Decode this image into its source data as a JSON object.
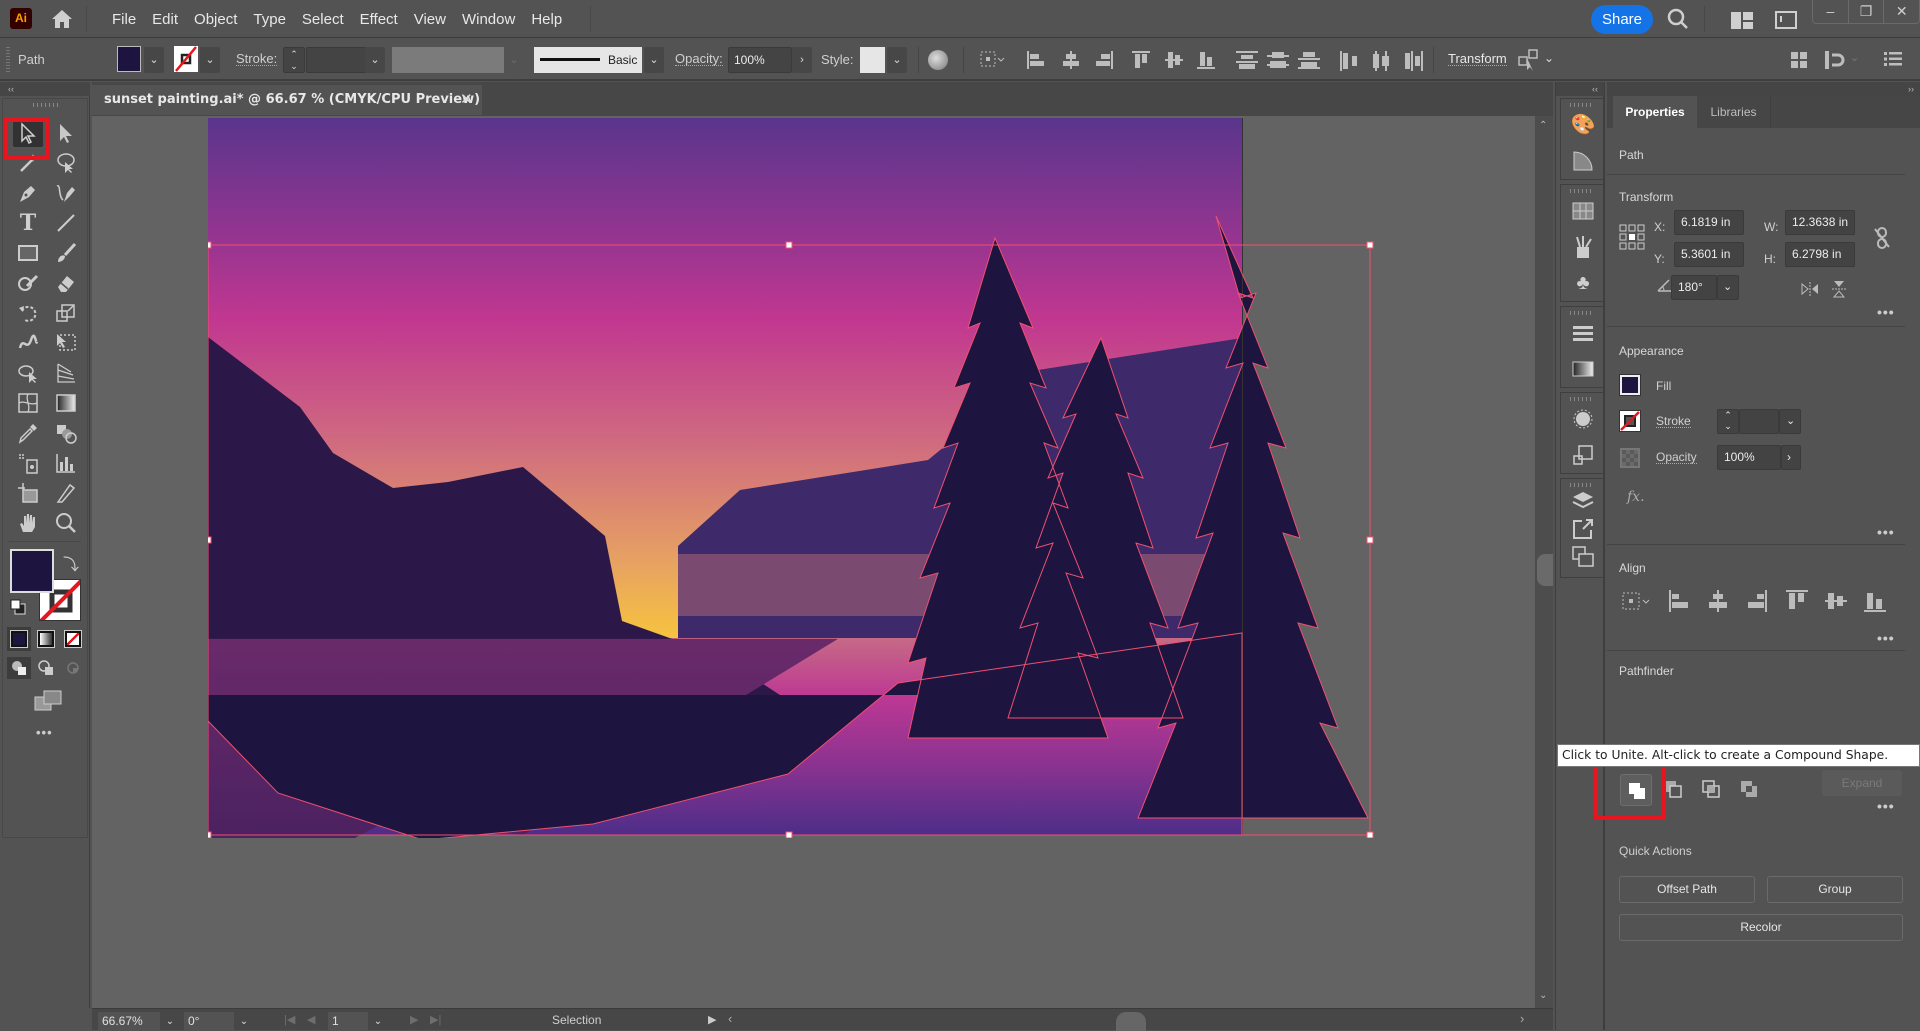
{
  "app": {
    "logo_text": "Ai",
    "menu": [
      "File",
      "Edit",
      "Object",
      "Type",
      "Select",
      "Effect",
      "View",
      "Window",
      "Help"
    ],
    "share_label": "Share",
    "window_controls": [
      "–",
      "❐",
      "✕"
    ]
  },
  "control_bar": {
    "selection_type": "Path",
    "fill_color": "#1e1440",
    "stroke_label": "Stroke:",
    "stroke_weight": "",
    "brush_label": "Basic",
    "opacity_label": "Opacity:",
    "opacity_value": "100%",
    "style_label": "Style:",
    "transform_label": "Transform"
  },
  "document": {
    "tab_title": "sunset painting.ai* @ 66.67 % (CMYK/CPU Preview)",
    "close_glyph": "✕"
  },
  "toolbar": {
    "active_tool": "selection-tool",
    "tools": [
      "selection-tool",
      "direct-selection-tool",
      "magic-wand-tool",
      "lasso-tool",
      "pen-tool",
      "curvature-tool",
      "type-tool",
      "line-segment-tool",
      "rectangle-tool",
      "paintbrush-tool",
      "shaper-tool",
      "eraser-tool",
      "rotate-tool",
      "scale-tool",
      "warp-tool",
      "free-transform-tool",
      "shape-builder-tool",
      "perspective-grid-tool",
      "mesh-tool",
      "gradient-tool",
      "eyedropper-tool",
      "blend-tool",
      "symbol-sprayer-tool",
      "column-graph-tool",
      "artboard-tool",
      "slice-tool",
      "hand-tool",
      "zoom-tool"
    ],
    "fill_color": "#1e1440",
    "stroke": "none",
    "more_glyph": "•••"
  },
  "status_bar": {
    "zoom": "66.67%",
    "rotation": "0°",
    "artboard_number": "1",
    "current_tool": "Selection"
  },
  "properties_panel": {
    "tabs": [
      "Properties",
      "Libraries"
    ],
    "active_tab": "Properties",
    "object_type": "Path",
    "transform": {
      "title": "Transform",
      "x_label": "X:",
      "x": "6.1819 in",
      "y_label": "Y:",
      "y": "5.3601 in",
      "w_label": "W:",
      "w": "12.3638 in",
      "h_label": "H:",
      "h": "6.2798 in",
      "angle": "180°"
    },
    "appearance": {
      "title": "Appearance",
      "fill_label": "Fill",
      "fill_color": "#1e1440",
      "stroke_label": "Stroke",
      "stroke_value": "",
      "opacity_label": "Opacity",
      "opacity_value": "100%",
      "fx_label": "fx."
    },
    "align": {
      "title": "Align"
    },
    "pathfinder": {
      "title": "Pathfinder",
      "operations": [
        "unite",
        "minus-front",
        "intersect",
        "exclude"
      ],
      "expand_label": "Expand",
      "highlighted": "unite"
    },
    "tooltip": "Click to Unite. Alt-click to create a Compound Shape.",
    "quick_actions": {
      "title": "Quick Actions",
      "buttons": [
        "Offset Path",
        "Group",
        "Recolor"
      ]
    },
    "more_glyph": "•••"
  },
  "colors": {
    "accent": "#1473e6",
    "highlight_red": "#e8141e",
    "selection_outline": "#f0506e",
    "dark_purple": "#1e1440"
  }
}
